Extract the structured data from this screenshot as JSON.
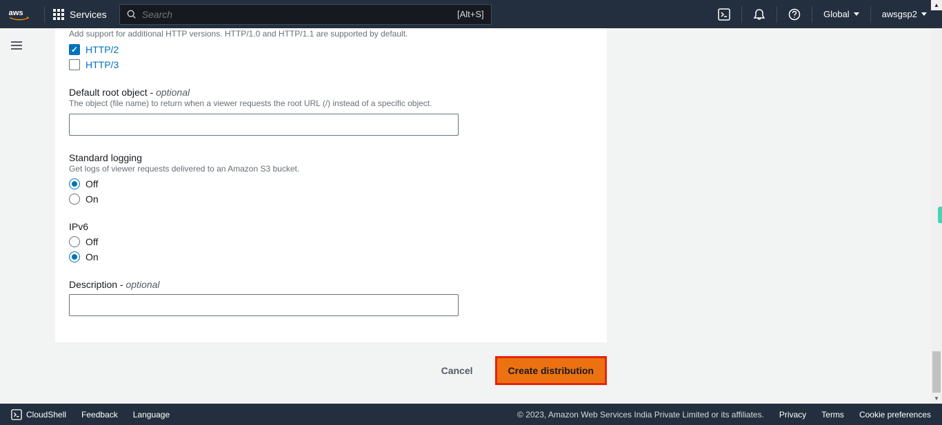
{
  "header": {
    "services_label": "Services",
    "search_placeholder": "Search",
    "search_hint": "[Alt+S]",
    "region": "Global",
    "account": "awsgsp2"
  },
  "form": {
    "http_versions": {
      "help": "Add support for additional HTTP versions. HTTP/1.0 and HTTP/1.1 are supported by default.",
      "http2_label": "HTTP/2",
      "http2_checked": true,
      "http3_label": "HTTP/3",
      "http3_checked": false
    },
    "root_object": {
      "label": "Default root object - ",
      "optional": "optional",
      "help": "The object (file name) to return when a viewer requests the root URL (/) instead of a specific object.",
      "value": ""
    },
    "logging": {
      "label": "Standard logging",
      "help": "Get logs of viewer requests delivered to an Amazon S3 bucket.",
      "off_label": "Off",
      "on_label": "On",
      "selected": "off"
    },
    "ipv6": {
      "label": "IPv6",
      "off_label": "Off",
      "on_label": "On",
      "selected": "on"
    },
    "description": {
      "label": "Description - ",
      "optional": "optional",
      "value": ""
    }
  },
  "actions": {
    "cancel": "Cancel",
    "create": "Create distribution"
  },
  "footer": {
    "cloudshell": "CloudShell",
    "feedback": "Feedback",
    "language": "Language",
    "copyright": "© 2023, Amazon Web Services India Private Limited or its affiliates.",
    "privacy": "Privacy",
    "terms": "Terms",
    "cookies": "Cookie preferences"
  }
}
